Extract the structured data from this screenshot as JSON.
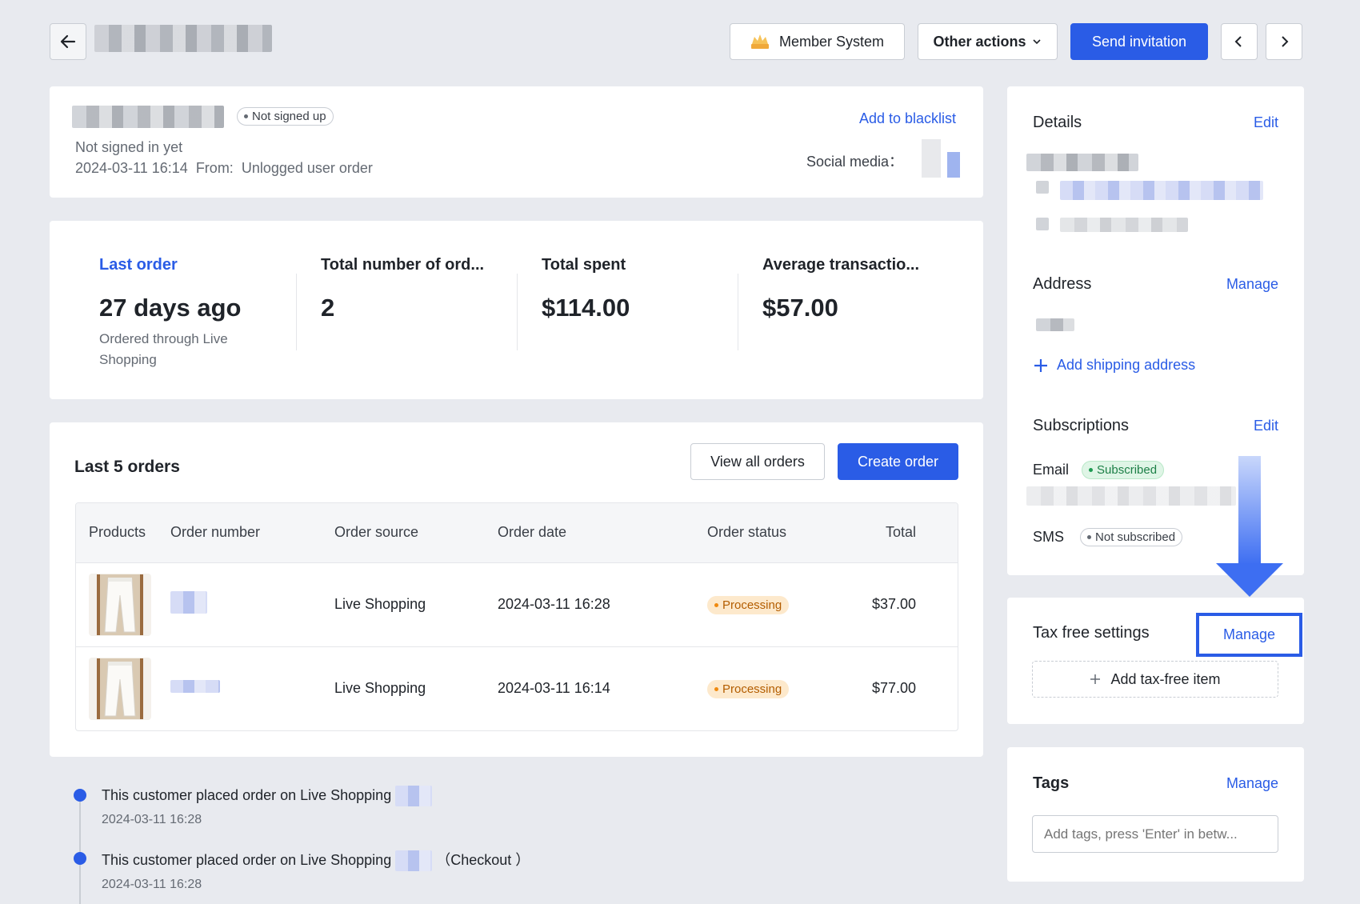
{
  "topbar": {
    "member_system_label": "Member System",
    "other_actions_label": "Other actions",
    "send_invitation_label": "Send invitation"
  },
  "profile": {
    "signup_status": "Not signed up",
    "signin_text": "Not signed in yet",
    "created_at": "2024-03-11 16:14",
    "from_label": "From:",
    "from_value": "Unlogged user order",
    "blacklist_link": "Add to blacklist",
    "social_media_label": "Social media："
  },
  "stats": [
    {
      "label": "Last order",
      "value": "27 days ago",
      "sub": "Ordered through Live Shopping"
    },
    {
      "label": "Total number of ord...",
      "value": "2"
    },
    {
      "label": "Total spent",
      "value": "$114.00"
    },
    {
      "label": "Average transactio...",
      "value": "$57.00"
    }
  ],
  "orders": {
    "title": "Last 5 orders",
    "view_all_label": "View all orders",
    "create_label": "Create order",
    "columns": [
      "Products",
      "Order number",
      "Order source",
      "Order date",
      "Order status",
      "Total"
    ],
    "rows": [
      {
        "source": "Live Shopping",
        "date": "2024-03-11 16:28",
        "status": "Processing",
        "total": "$37.00"
      },
      {
        "source": "Live Shopping",
        "date": "2024-03-11 16:14",
        "status": "Processing",
        "total": "$77.00"
      }
    ]
  },
  "timeline": [
    {
      "text": "This customer placed order on Live Shopping",
      "suffix": "",
      "time": "2024-03-11 16:28"
    },
    {
      "text": "This customer placed order on Live Shopping",
      "suffix": "（Checkout ）",
      "time": "2024-03-11 16:28"
    }
  ],
  "details": {
    "title": "Details",
    "edit_label": "Edit"
  },
  "address": {
    "title": "Address",
    "manage_label": "Manage",
    "add_label": "Add shipping address"
  },
  "subscriptions": {
    "title": "Subscriptions",
    "edit_label": "Edit",
    "email_label": "Email",
    "email_status": "Subscribed",
    "sms_label": "SMS",
    "sms_status": "Not subscribed"
  },
  "tax": {
    "title": "Tax free settings",
    "manage_label": "Manage",
    "add_label": "Add tax-free item"
  },
  "tags": {
    "title": "Tags",
    "manage_label": "Manage",
    "placeholder": "Add tags, press 'Enter' in betw..."
  },
  "colors": {
    "accent": "#2a5ce6",
    "highlight_box": "#2a5ce6",
    "arrow": "#3d6ef2"
  },
  "icons": [
    "arrow-left-icon",
    "crown-icon",
    "chevron-down-icon",
    "chevron-left-icon",
    "chevron-right-icon",
    "plus-icon",
    "arrow-down-icon"
  ]
}
